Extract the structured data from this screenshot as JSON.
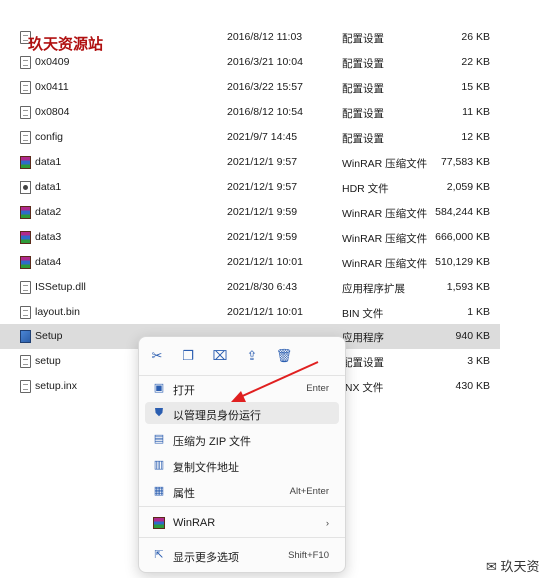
{
  "watermark": "玖天资源站",
  "files": [
    {
      "name": "",
      "date": "2016/8/12 11:03",
      "type": "配置设置",
      "size": "26 KB",
      "icon": "config-file-icon"
    },
    {
      "name": "0x0409",
      "date": "2016/3/21 10:04",
      "type": "配置设置",
      "size": "22 KB",
      "icon": "config-file-icon"
    },
    {
      "name": "0x0411",
      "date": "2016/3/22 15:57",
      "type": "配置设置",
      "size": "15 KB",
      "icon": "config-file-icon"
    },
    {
      "name": "0x0804",
      "date": "2016/8/12 10:54",
      "type": "配置设置",
      "size": "11 KB",
      "icon": "config-file-icon"
    },
    {
      "name": "config",
      "date": "2021/9/7 14:45",
      "type": "配置设置",
      "size": "12 KB",
      "icon": "config-file-icon"
    },
    {
      "name": "data1",
      "date": "2021/12/1 9:57",
      "type": "WinRAR 压缩文件",
      "size": "77,583 KB",
      "icon": "winrar-archive-icon"
    },
    {
      "name": "data1",
      "date": "2021/12/1 9:57",
      "type": "HDR 文件",
      "size": "2,059 KB",
      "icon": "hdr-file-icon"
    },
    {
      "name": "data2",
      "date": "2021/12/1 9:59",
      "type": "WinRAR 压缩文件",
      "size": "584,244 KB",
      "icon": "winrar-archive-icon"
    },
    {
      "name": "data3",
      "date": "2021/12/1 9:59",
      "type": "WinRAR 压缩文件",
      "size": "666,000 KB",
      "icon": "winrar-archive-icon"
    },
    {
      "name": "data4",
      "date": "2021/12/1 10:01",
      "type": "WinRAR 压缩文件",
      "size": "510,129 KB",
      "icon": "winrar-archive-icon"
    },
    {
      "name": "ISSetup.dll",
      "date": "2021/8/30 6:43",
      "type": "应用程序扩展",
      "size": "1,593 KB",
      "icon": "dll-file-icon"
    },
    {
      "name": "layout.bin",
      "date": "2021/12/1 10:01",
      "type": "BIN 文件",
      "size": "1 KB",
      "icon": "bin-file-icon"
    },
    {
      "name": "Setup",
      "date": "",
      "type": "应用程序",
      "size": "940 KB",
      "icon": "setup-app-icon"
    },
    {
      "name": "setup",
      "date": "",
      "type": "配置设置",
      "size": "3 KB",
      "icon": "config-file-icon"
    },
    {
      "name": "setup.inx",
      "date": "",
      "type": "INX 文件",
      "size": "430 KB",
      "icon": "inx-file-icon"
    }
  ],
  "toolbar": [
    "cut-icon",
    "copy-icon",
    "rename-icon",
    "share-icon",
    "delete-icon"
  ],
  "menu": [
    {
      "label": "打开",
      "shortcut": "Enter",
      "icon": "open-icon"
    },
    {
      "label": "以管理员身份运行",
      "shortcut": "",
      "icon": "run-as-admin-icon"
    },
    {
      "label": "压缩为 ZIP 文件",
      "shortcut": "",
      "icon": "zip-icon"
    },
    {
      "label": "复制文件地址",
      "shortcut": "",
      "icon": "copy-path-icon"
    },
    {
      "label": "属性",
      "shortcut": "Alt+Enter",
      "icon": "properties-icon"
    },
    {
      "label": "WinRAR",
      "shortcut": "",
      "icon": "winrar-icon"
    },
    {
      "label": "显示更多选项",
      "shortcut": "Shift+F10",
      "icon": "more-options-icon"
    }
  ],
  "wechat_text": "玖天资",
  "colors": {
    "accent": "#2a5db0",
    "arrow": "#e02020",
    "selected_row": "#dcdcdc"
  }
}
